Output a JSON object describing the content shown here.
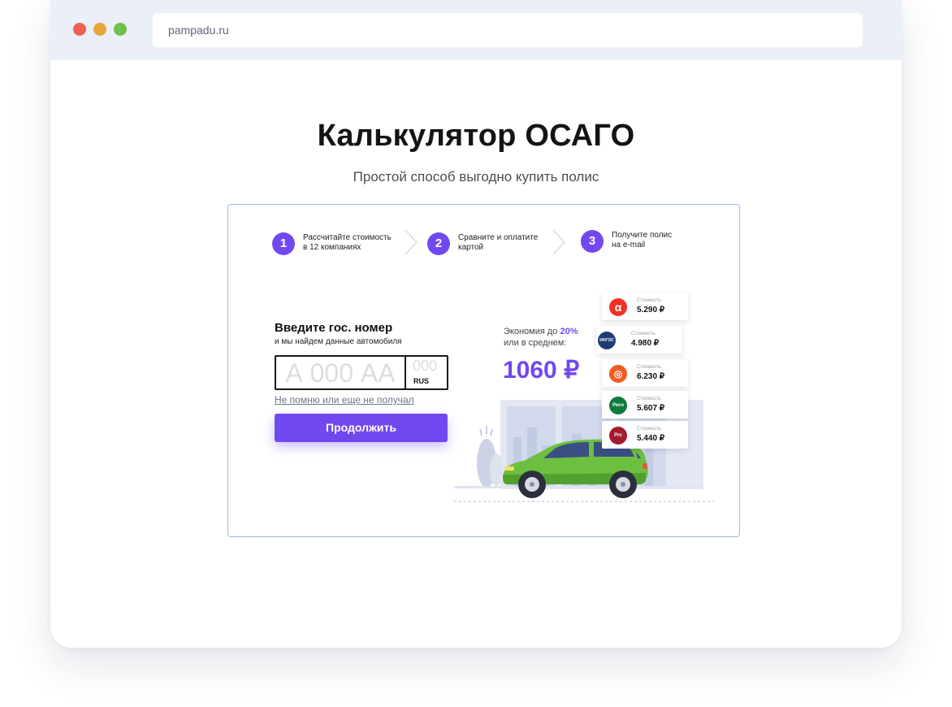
{
  "browser": {
    "url": "pampadu.ru",
    "colors": {
      "close": "#ec6252",
      "minimize": "#e8a63a",
      "maximize": "#6dc04a"
    }
  },
  "page": {
    "title": "Калькулятор ОСАГО",
    "subtitle": "Простой способ выгодно купить полис"
  },
  "steps": [
    {
      "num": "1",
      "label": "Рассчитайте стоимость\nв 12 компаниях"
    },
    {
      "num": "2",
      "label": "Сравните и оплатите\nкартой"
    },
    {
      "num": "3",
      "label": "Получите полис\nна e-mail"
    }
  ],
  "form": {
    "title": "Введите гос. номер",
    "subtitle": "и мы найдем данные автомобиля",
    "plate_placeholder": "А 000 АА",
    "region_placeholder": "000",
    "country": "RUS",
    "forgot_link": "Не помню или еще не получал",
    "submit": "Продолжить"
  },
  "savings": {
    "prefix": "Экономия до",
    "percent": "20%",
    "line2": "или в среднем:",
    "amount": "1060 ₽"
  },
  "offers": [
    {
      "logo": "α",
      "logo_color": "#ef3124",
      "caption": "Стоимость",
      "price": "5.290 ₽"
    },
    {
      "logo": "ИНГОС",
      "logo_color": "#1e3c74",
      "caption": "Стоимость",
      "price": "4.980 ₽"
    },
    {
      "logo": "◎",
      "logo_color": "#f15a22",
      "caption": "Стоимость",
      "price": "6.230 ₽"
    },
    {
      "logo": "Ресо",
      "logo_color": "#0f7a3a",
      "caption": "Стоимость",
      "price": "5.607 ₽"
    },
    {
      "logo": "Ргс",
      "logo_color": "#a6192e",
      "caption": "Стоимость",
      "price": "5.440 ₽"
    }
  ],
  "theme": {
    "accent": "#7148f0",
    "car": "#6cbf3f"
  }
}
